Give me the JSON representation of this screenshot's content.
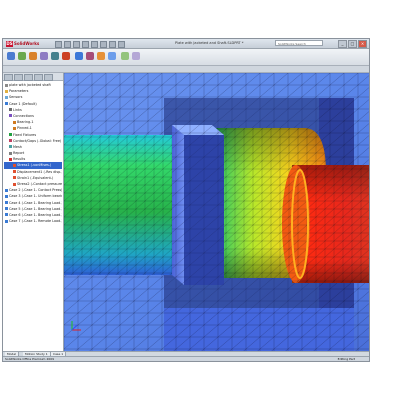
{
  "app": {
    "brand": "SolidWorks",
    "window_title": "Plate with Jacketed and Shaft.SLDPRT *",
    "search_placeholder": "SolidWorks Search"
  },
  "window_buttons": [
    "_",
    "□",
    "×"
  ],
  "tree": {
    "items": [
      {
        "label": "plate with jacketed shaft",
        "icon": "part-icon",
        "indent": 0,
        "selected": false
      },
      {
        "label": "Parameters",
        "icon": "folder-icon",
        "indent": 0,
        "selected": false
      },
      {
        "label": "Sensors",
        "icon": "sensor-icon",
        "indent": 0,
        "selected": false
      },
      {
        "label": "Case 1 (Default)",
        "icon": "study-icon",
        "indent": 0,
        "selected": false
      },
      {
        "label": "Links",
        "icon": "link-icon",
        "indent": 1,
        "selected": false
      },
      {
        "label": "Connections",
        "icon": "connection-icon",
        "indent": 1,
        "selected": false
      },
      {
        "label": "Bearing-1",
        "icon": "bearing-icon",
        "indent": 2,
        "selected": false
      },
      {
        "label": "Pinned-1",
        "icon": "pin-icon",
        "indent": 2,
        "selected": false
      },
      {
        "label": "Fixed Fixtures",
        "icon": "fixture-icon",
        "indent": 1,
        "selected": false
      },
      {
        "label": "Contact/Gaps (-Global: Free)",
        "icon": "contact-icon",
        "indent": 1,
        "selected": false
      },
      {
        "label": "Mesh",
        "icon": "mesh-icon",
        "indent": 1,
        "selected": false
      },
      {
        "label": "Report",
        "icon": "report-icon",
        "indent": 1,
        "selected": false
      },
      {
        "label": "Results",
        "icon": "results-icon",
        "indent": 1,
        "selected": false
      },
      {
        "label": "Stress1 (-vonMises-)",
        "icon": "plot-icon",
        "indent": 2,
        "selected": true
      },
      {
        "label": "Displacement1 (-Res disp-)",
        "icon": "plot-icon",
        "indent": 2,
        "selected": false
      },
      {
        "label": "Strain1 (-Equivalent-)",
        "icon": "plot-icon",
        "indent": 2,
        "selected": false
      },
      {
        "label": "Stress2 (-Contact pressure-)",
        "icon": "plot-icon",
        "indent": 2,
        "selected": false
      },
      {
        "label": "Case 2 (-Case 1- Contact Press)",
        "icon": "study-icon",
        "indent": 0,
        "selected": false
      },
      {
        "label": "Case 3 (-Case 1- Uniform bearing)",
        "icon": "study-icon",
        "indent": 0,
        "selected": false
      },
      {
        "label": "Case 4 (-Case 1- Bearing Load-)",
        "icon": "study-icon",
        "indent": 0,
        "selected": false
      },
      {
        "label": "Case 5 (-Case 1- Bearing Load-)",
        "icon": "study-icon",
        "indent": 0,
        "selected": false
      },
      {
        "label": "Case 6 (-Case 1- Bearing Load-)",
        "icon": "study-icon",
        "indent": 0,
        "selected": false
      },
      {
        "label": "Case 7 (-Case 1- Remote Load-)",
        "icon": "study-icon",
        "indent": 0,
        "selected": false
      }
    ]
  },
  "bottom_tabs": [
    "Model",
    "Motion Study 1",
    "Case 1"
  ],
  "status": {
    "left": "SolidWorks Office Premium 2009",
    "right": "Editing Part"
  },
  "colors": {
    "accent_selection": "#3366cc",
    "stress_low": "#2a4bd8",
    "stress_high": "#e6201a",
    "brand_red": "#c8102e"
  }
}
